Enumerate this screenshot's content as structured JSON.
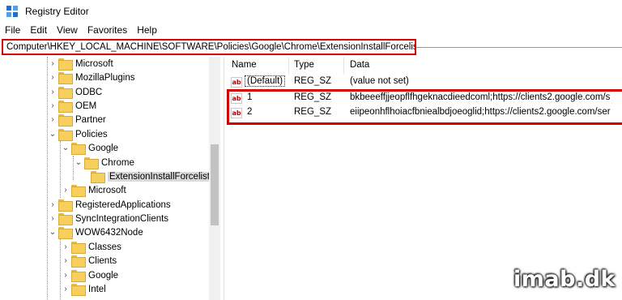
{
  "window": {
    "title": "Registry Editor",
    "icon": "registry-editor-icon"
  },
  "menu": [
    "File",
    "Edit",
    "View",
    "Favorites",
    "Help"
  ],
  "address": {
    "path": "Computer\\HKEY_LOCAL_MACHINE\\SOFTWARE\\Policies\\Google\\Chrome\\ExtensionInstallForcelist"
  },
  "tree": {
    "items": [
      {
        "label": "Microsoft",
        "expanded": false
      },
      {
        "label": "MozillaPlugins",
        "expanded": false
      },
      {
        "label": "ODBC",
        "expanded": false
      },
      {
        "label": "OEM",
        "expanded": false
      },
      {
        "label": "Partner",
        "expanded": false
      },
      {
        "label": "Policies",
        "expanded": true
      },
      {
        "label": "Google",
        "expanded": true
      },
      {
        "label": "Chrome",
        "expanded": true
      },
      {
        "label": "ExtensionInstallForcelist",
        "selected": true
      },
      {
        "label": "Microsoft",
        "expanded": false
      },
      {
        "label": "RegisteredApplications",
        "expanded": false
      },
      {
        "label": "SyncIntegrationClients",
        "expanded": false
      },
      {
        "label": "WOW6432Node",
        "expanded": true
      },
      {
        "label": "Classes",
        "expanded": false
      },
      {
        "label": "Clients",
        "expanded": false
      },
      {
        "label": "Google",
        "expanded": false
      },
      {
        "label": "Intel",
        "expanded": false
      }
    ]
  },
  "list": {
    "headers": {
      "name": "Name",
      "type": "Type",
      "data": "Data"
    },
    "rows": [
      {
        "name": "(Default)",
        "type": "REG_SZ",
        "data": "(value not set)",
        "icon": "ab"
      },
      {
        "name": "1",
        "type": "REG_SZ",
        "data": "bkbeeeffjjeopflfhgeknacdieedcoml;https://clients2.google.com/s",
        "icon": "ab"
      },
      {
        "name": "2",
        "type": "REG_SZ",
        "data": "eiipeonhflhoiacfbniealbdjoeoglid;https://clients2.google.com/ser",
        "icon": "ab"
      }
    ]
  },
  "watermark": "imab.dk",
  "colors": {
    "highlight": "#d40000",
    "folder": "#f7cf5d"
  }
}
